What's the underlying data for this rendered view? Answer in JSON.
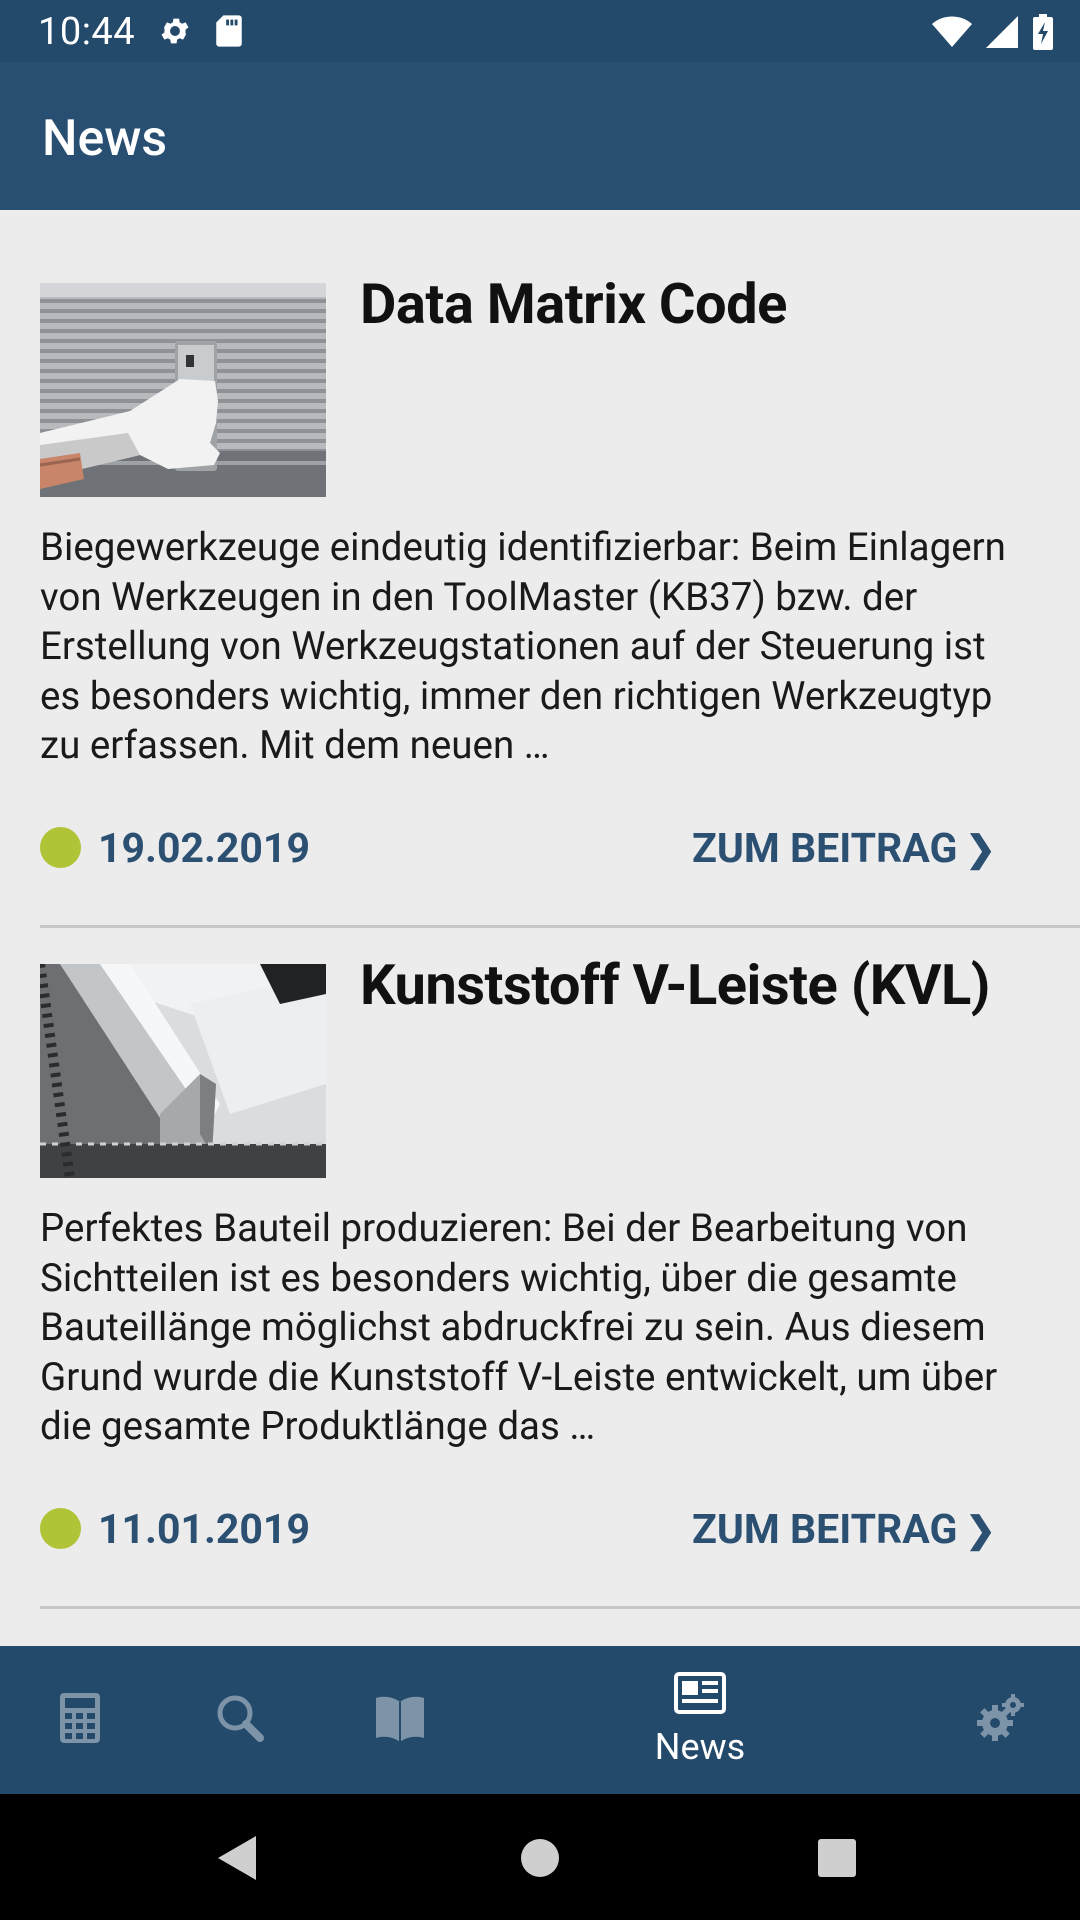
{
  "status_bar": {
    "time": "10:44",
    "left_icons": [
      "gear-icon",
      "sd-card-icon"
    ],
    "right_icons": [
      "wifi-icon",
      "cell-signal-icon",
      "battery-charging-icon"
    ]
  },
  "app_bar": {
    "title": "News"
  },
  "articles": [
    {
      "title": "Data Matrix Code",
      "excerpt": "Biegewerkzeuge eindeutig identifizierbar: Beim Einlagern von Werkzeugen in den ToolMaster (KB37) bzw. der Erstellung von Werkzeugstationen auf der Steuerung ist es besonders wichtig, immer den richtigen Werkzeugtyp zu erfassen. Mit dem neuen …",
      "date": "19.02.2019",
      "link_label": "ZUM BEITRAG"
    },
    {
      "title": "Kunststoff V-Leiste (KVL)",
      "excerpt": "Perfektes Bauteil produzieren: Bei der Bearbeitung von Sichtteilen ist es besonders wichtig, über die gesamte Bauteillänge möglichst abdruckfrei zu sein. Aus diesem Grund wurde die Kunststoff V-Leiste entwickelt, um über die gesamte Produktlänge das …",
      "date": "11.01.2019",
      "link_label": "ZUM BEITRAG"
    }
  ],
  "bottom_nav": {
    "items": [
      {
        "icon": "calculator-icon"
      },
      {
        "icon": "search-icon"
      },
      {
        "icon": "book-icon"
      },
      {
        "icon": "newspaper-icon",
        "label": "News",
        "active": true
      },
      {
        "icon": "settings-gears-icon"
      }
    ]
  },
  "colors": {
    "app_bar": "#284f72",
    "status_bar": "#234a6b",
    "accent_dot": "#b1c438",
    "link": "#2b5072",
    "background": "#ececed"
  }
}
